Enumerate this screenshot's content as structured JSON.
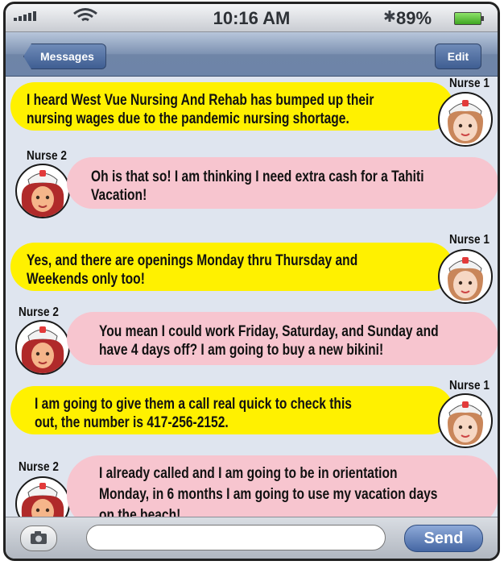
{
  "status_bar": {
    "carrier": "ooll",
    "time": "10:16 AM",
    "battery_percent": "89%",
    "battery_level": 0.89,
    "icons": [
      "signal-bars-icon",
      "wifi-icon",
      "bluetooth-icon",
      "battery-icon"
    ]
  },
  "nav": {
    "back_label": "Messages",
    "edit_label": "Edit"
  },
  "messages": [
    {
      "sender": "Nurse 1",
      "color": "#fff100",
      "lines": [
        "I heard West Vue Nursing And Rehab has bumped up their",
        "nursing wages due to the pandemic nursing shortage."
      ]
    },
    {
      "sender": "Nurse 2",
      "color": "#f7c5cf",
      "lines": [
        "Oh is that so! I am thinking I need extra cash for a Tahiti",
        "Vacation!"
      ]
    },
    {
      "sender": "Nurse 1",
      "color": "#fff100",
      "lines": [
        "Yes, and there are openings Monday thru Thursday and",
        "Weekends only too!"
      ]
    },
    {
      "sender": "Nurse 2",
      "color": "#f7c5cf",
      "lines": [
        "You mean I could work Friday, Saturday, and Sunday and",
        "have 4 days off?  I am going to buy a new bikini!"
      ]
    },
    {
      "sender": "Nurse 1",
      "color": "#fff100",
      "lines": [
        "I am going to give them a call real quick to check this",
        "out, the number is 417-256-2152."
      ]
    },
    {
      "sender": "Nurse 2",
      "color": "#f7c5cf",
      "lines": [
        "I already called and I am going to be in orientation",
        "Monday, in 6 months I am going to use my vacation days",
        "on the beach!"
      ]
    }
  ],
  "composer": {
    "placeholder": "",
    "send_label": "Send"
  }
}
